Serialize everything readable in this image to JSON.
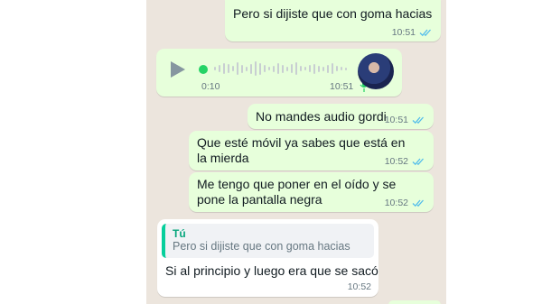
{
  "messages": [
    {
      "id": "m1",
      "text": "Pero si dijiste que con goma hacias",
      "time": "10:51"
    },
    {
      "id": "voice",
      "duration": "0:10",
      "time": "10:51"
    },
    {
      "id": "m3",
      "text": "No mandes audio gordi",
      "time": "10:51"
    },
    {
      "id": "m4",
      "text": "Que esté móvil ya sabes que está en la mierda",
      "time": "10:52"
    },
    {
      "id": "m5",
      "text": "Me tengo que poner en el oído y se pone la pantalla negra",
      "time": "10:52"
    },
    {
      "id": "m6",
      "quote_author": "Tú",
      "quote_text": "Pero si dijiste que con goma hacias",
      "text": "Si al principio y luego era que se sacó",
      "time": "10:52"
    }
  ],
  "colors": {
    "chat_background": "#ece5dd",
    "outgoing_bubble": "#e7ffdb",
    "incoming_bubble": "#ffffff",
    "read_ticks": "#53bdeb",
    "voice_dot": "#25d366",
    "quote_accent": "#06cf9c"
  },
  "icons": [
    "play-icon",
    "voice-progress-dot",
    "waveform",
    "contact-avatar",
    "mic-icon",
    "double-check-icon"
  ]
}
